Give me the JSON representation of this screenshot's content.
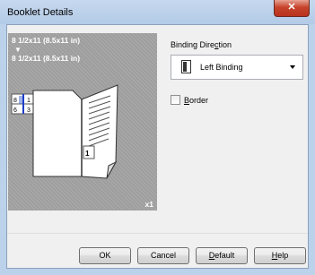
{
  "window": {
    "title": "Booklet Details",
    "close_icon": "close-icon"
  },
  "preview": {
    "input_size": "8 1/2x11 (8.5x11 in)",
    "output_size": "8 1/2x11 (8.5x11 in)",
    "arrow": "▼",
    "copies": "x1",
    "page_labels": [
      "8",
      "1",
      "6",
      "3",
      "1"
    ]
  },
  "binding": {
    "label_prefix": "Binding Dire",
    "label_underline": "c",
    "label_suffix": "tion",
    "selected": "Left Binding"
  },
  "border": {
    "label_underline": "B",
    "label_suffix": "order",
    "checked": false
  },
  "buttons": {
    "ok": "OK",
    "cancel": "Cancel",
    "default_underline": "D",
    "default_suffix": "efault",
    "help_underline": "H",
    "help_suffix": "elp"
  },
  "colors": {
    "preview_bg": "#9e9e9e",
    "close_red": "#c7432b",
    "accent_blue": "#1c3fc8"
  }
}
